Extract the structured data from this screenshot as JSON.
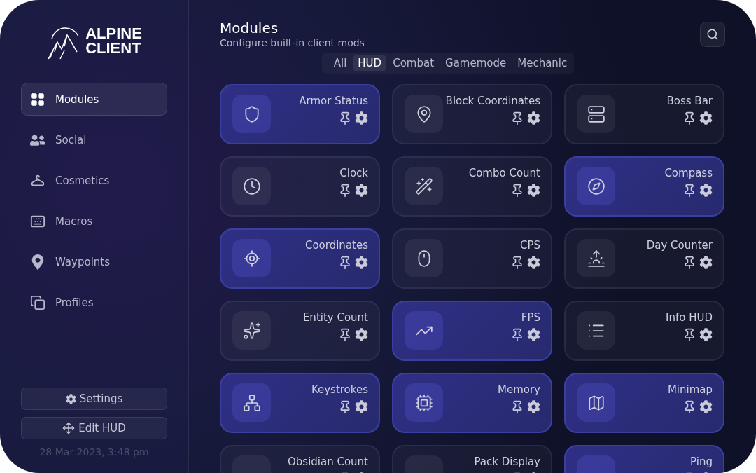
{
  "brand": {
    "line_1": "ALPINE",
    "line_2": "CLIENT"
  },
  "sidebar": {
    "items": [
      {
        "label": "Modules",
        "selected": true
      },
      {
        "label": "Social",
        "selected": false
      },
      {
        "label": "Cosmetics",
        "selected": false
      },
      {
        "label": "Macros",
        "selected": false
      },
      {
        "label": "Waypoints",
        "selected": false
      },
      {
        "label": "Profiles",
        "selected": false
      }
    ],
    "buttons": [
      "Settings",
      "Edit HUD"
    ],
    "timestamp": "28 Mar 2023, 3:48 pm"
  },
  "header": {
    "title": "Modules",
    "subtitle": "Configure built-in client mods"
  },
  "filters": [
    {
      "label": "All",
      "selected": false
    },
    {
      "label": "HUD",
      "selected": true
    },
    {
      "label": "Combat",
      "selected": false
    },
    {
      "label": "Gamemode",
      "selected": false
    },
    {
      "label": "Mechanic",
      "selected": false
    }
  ],
  "modules": [
    {
      "name": "Armor Status",
      "on": true
    },
    {
      "name": "Block Coordinates",
      "on": false
    },
    {
      "name": "Boss Bar",
      "on": false
    },
    {
      "name": "Clock",
      "on": false
    },
    {
      "name": "Combo Count",
      "on": false
    },
    {
      "name": "Compass",
      "on": true
    },
    {
      "name": "Coordinates",
      "on": true
    },
    {
      "name": "CPS",
      "on": false
    },
    {
      "name": "Day Counter",
      "on": false
    },
    {
      "name": "Entity Count",
      "on": false
    },
    {
      "name": "FPS",
      "on": true
    },
    {
      "name": "Info HUD",
      "on": false
    },
    {
      "name": "Keystrokes",
      "on": true
    },
    {
      "name": "Memory",
      "on": true
    },
    {
      "name": "Minimap",
      "on": true
    },
    {
      "name": "Obsidian Count",
      "on": false
    },
    {
      "name": "Pack Display",
      "on": false
    },
    {
      "name": "Ping",
      "on": true
    }
  ]
}
